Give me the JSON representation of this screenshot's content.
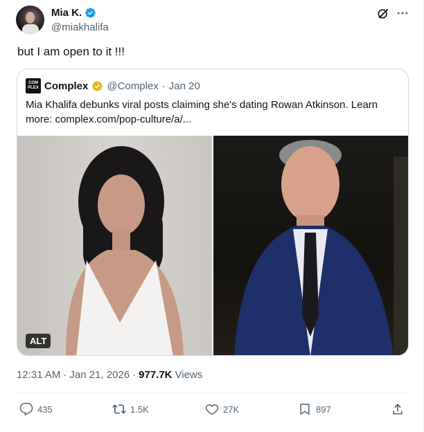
{
  "author": {
    "display_name": "Mia K.",
    "handle": "@miakhalifa",
    "verified_color": "#1d9bf0"
  },
  "tweet": {
    "text": "but I am open to it !!!"
  },
  "quoted": {
    "logo_text": "COM PLEX",
    "display_name": "Complex",
    "verified_color": "#e2b719",
    "handle": "@Complex",
    "separator": "·",
    "date": "Jan 20",
    "text": "Mia Khalifa debunks viral posts claiming she's dating Rowan Atkinson. Learn more: complex.com/pop-culture/a/...",
    "alt_label": "ALT"
  },
  "meta": {
    "time": "12:31 AM",
    "separator1": "·",
    "date": "Jan 21, 2026",
    "separator2": "·",
    "views_count": "977.7K",
    "views_label": "Views"
  },
  "actions": {
    "replies": "435",
    "reposts": "1.5K",
    "likes": "27K",
    "bookmarks": "897"
  },
  "colors": {
    "text_primary": "#0f1419",
    "text_secondary": "#536471",
    "border": "#cfd9de"
  }
}
